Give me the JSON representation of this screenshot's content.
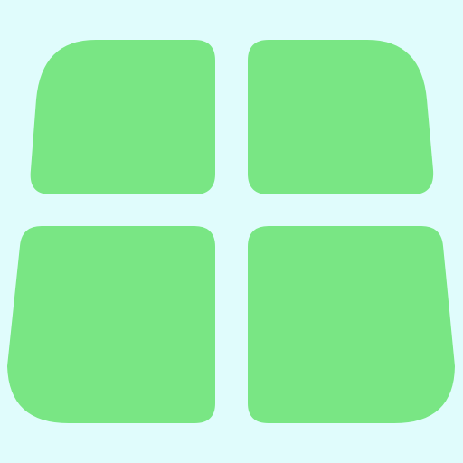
{
  "icon": {
    "name": "grid-icon",
    "background": "#e0fcfc",
    "tile_color": "#79e684"
  }
}
